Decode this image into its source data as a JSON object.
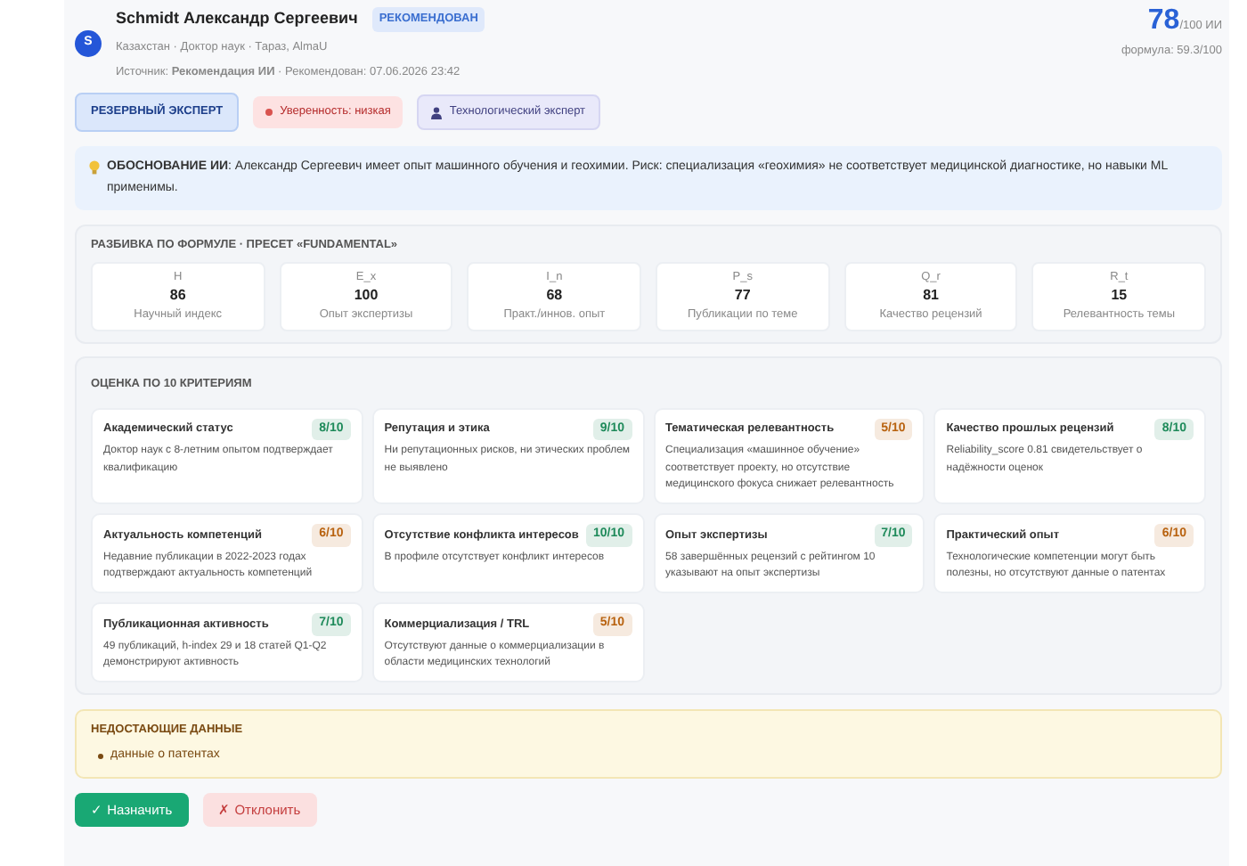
{
  "header": {
    "avatar": "S",
    "name": "Schmidt Александр Сергеевич",
    "status": "РЕКОМЕНДОВАН",
    "meta": "Казахстан · Доктор наук · Тараз, AlmaU",
    "source": "Источник: **Рекомендация ИИ** · Рекомендован: 07.06.2026 23:42",
    "score": "78",
    "score_suffix": "/100 ИИ",
    "formula": "формула: 59.3/100"
  },
  "chips": [
    {
      "kind": "role",
      "label": "РЕЗЕРВНЫЙ ЭКСПЕРТ"
    },
    {
      "kind": "confidence",
      "label": "Уверенность: низкая"
    },
    {
      "kind": "profile",
      "label": "Технологический эксперт"
    }
  ],
  "rationale": "**ОБОСНОВАНИЕ ИИ**: Александр Сергеевич имеет опыт машинного обучения и геохимии. Риск: специализация «геохимия» не соответствует медицинской диагностике, но навыки ML применимы.",
  "formula": {
    "title": "РАЗБИВКА ПО ФОРМУЛЕ · ПРЕСЕТ «FUNDAMENTAL»",
    "items": [
      {
        "code": "H",
        "value": "86",
        "label": "Научный индекс"
      },
      {
        "code": "E_x",
        "value": "100",
        "label": "Опыт экспертизы"
      },
      {
        "code": "I_n",
        "value": "68",
        "label": "Практ./иннов. опыт"
      },
      {
        "code": "P_s",
        "value": "77",
        "label": "Публикации по теме"
      },
      {
        "code": "Q_r",
        "value": "81",
        "label": "Качество рецензий"
      },
      {
        "code": "R_t",
        "value": "15",
        "label": "Релевантность темы"
      }
    ]
  },
  "criteria": {
    "title": "ОЦЕНКА ПО 10 КРИТЕРИЯМ",
    "items": [
      {
        "title": "Академический статус",
        "score": "8/10",
        "color": "#1e8a5a",
        "text": "Доктор наук с 8-летним опытом подтверждает квалификацию"
      },
      {
        "title": "Репутация и этика",
        "score": "9/10",
        "color": "#1e8a5a",
        "text": "Ни репутационных рисков, ни этических проблем не выявлено"
      },
      {
        "title": "Тематическая релевантность",
        "score": "5/10",
        "color": "#b8620f",
        "text": "Специализация «машинное обучение» соответствует проекту, но отсутствие медицинского фокуса снижает релевантность"
      },
      {
        "title": "Качество прошлых рецензий",
        "score": "8/10",
        "color": "#1e8a5a",
        "text": "Reliability_score 0.81 свидетельствует о надёжности оценок"
      },
      {
        "title": "Актуальность компетенций",
        "score": "6/10",
        "color": "#b8620f",
        "text": "Недавние публикации в 2022-2023 годах подтверждают актуальность компетенций"
      },
      {
        "title": "Отсутствие конфликта интересов",
        "score": "10/10",
        "color": "#1e8a5a",
        "text": "В профиле отсутствует конфликт интересов"
      },
      {
        "title": "Опыт экспертизы",
        "score": "7/10",
        "color": "#1e8a5a",
        "text": "58 завершённых рецензий с рейтингом 10 указывают на опыт экспертизы"
      },
      {
        "title": "Практический опыт",
        "score": "6/10",
        "color": "#b8620f",
        "text": "Технологические компетенции могут быть полезны, но отсутствуют данные о патентах"
      },
      {
        "title": "Публикационная активность",
        "score": "7/10",
        "color": "#1e8a5a",
        "text": "49 публикаций, h-index 29 и 18 статей Q1-Q2 демонстрируют активность"
      },
      {
        "title": "Коммерциализация / TRL",
        "score": "5/10",
        "color": "#b8620f",
        "text": "Отсутствуют данные о коммерциализации в области медицинских технологий"
      }
    ]
  },
  "missing": {
    "title": "НЕДОСТАЮЩИЕ ДАННЫЕ",
    "items": [
      "данные о патентах"
    ]
  },
  "buttons": [
    {
      "kind": "approve",
      "label": "✓ Назначить"
    },
    {
      "kind": "reject",
      "label": "✗ Отклонить"
    }
  ]
}
